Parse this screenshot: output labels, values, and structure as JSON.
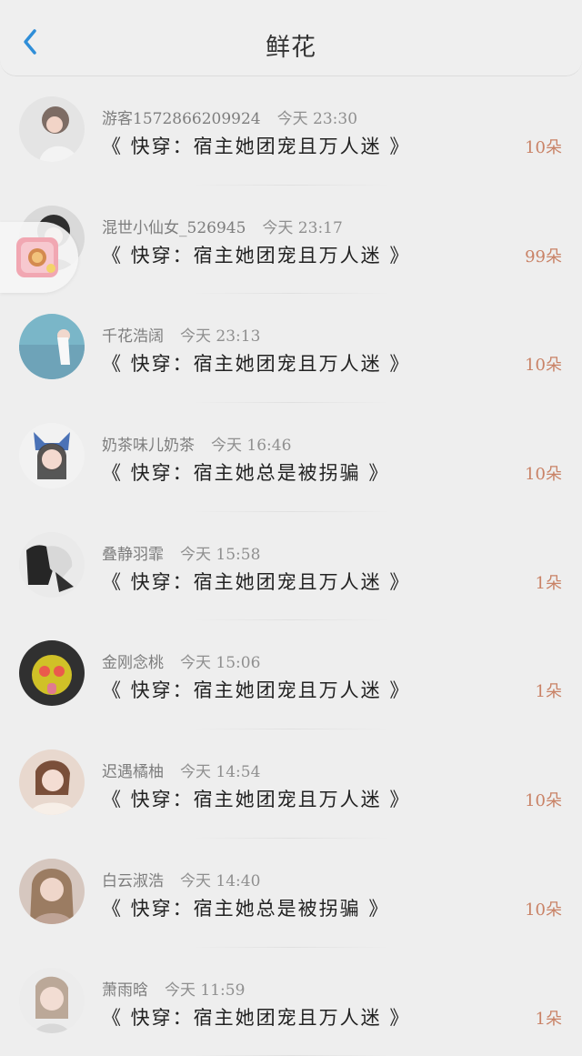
{
  "header": {
    "title": "鲜花",
    "back_icon": "chevron-left-icon",
    "accent": "#2f8ed8"
  },
  "float_widget": {
    "icon": "gift-badge-icon"
  },
  "records": [
    {
      "user": "游客1572866209924",
      "time": "今天 23:30",
      "book": "《 快穿：宿主她团宠且万人迷 》",
      "count": "10朵",
      "avatar": "avatar-1"
    },
    {
      "user": "混世小仙女_526945",
      "time": "今天 23:17",
      "book": "《 快穿：宿主她团宠且万人迷 》",
      "count": "99朵",
      "avatar": "avatar-2"
    },
    {
      "user": "千花浩阔",
      "time": "今天 23:13",
      "book": "《 快穿：宿主她团宠且万人迷 》",
      "count": "10朵",
      "avatar": "avatar-3"
    },
    {
      "user": "奶茶味儿奶茶",
      "time": "今天 16:46",
      "book": "《 快穿：宿主她总是被拐骗 》",
      "count": "10朵",
      "avatar": "avatar-4"
    },
    {
      "user": "叠静羽霏",
      "time": "今天 15:58",
      "book": "《 快穿：宿主她团宠且万人迷 》",
      "count": "1朵",
      "avatar": "avatar-5"
    },
    {
      "user": "金刚念桃",
      "time": "今天 15:06",
      "book": "《 快穿：宿主她团宠且万人迷 》",
      "count": "1朵",
      "avatar": "avatar-6"
    },
    {
      "user": "迟遇橘柚",
      "time": "今天 14:54",
      "book": "《 快穿：宿主她团宠且万人迷 》",
      "count": "10朵",
      "avatar": "avatar-7"
    },
    {
      "user": "白云淑浩",
      "time": "今天 14:40",
      "book": "《 快穿：宿主她总是被拐骗 》",
      "count": "10朵",
      "avatar": "avatar-8"
    },
    {
      "user": "萧雨晗",
      "time": "今天 11:59",
      "book": "《 快穿：宿主她团宠且万人迷 》",
      "count": "1朵",
      "avatar": "avatar-9"
    }
  ]
}
